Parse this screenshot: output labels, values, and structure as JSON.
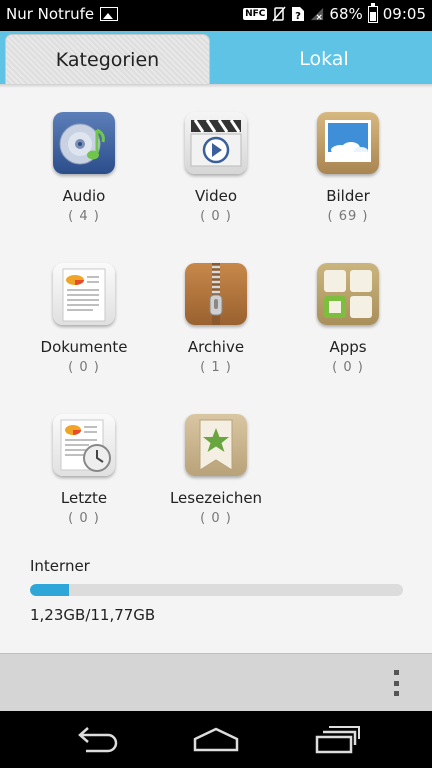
{
  "status_bar": {
    "carrier": "Nur Notrufe",
    "nfc": "NFC",
    "battery": "68%",
    "time": "09:05"
  },
  "tabs": [
    {
      "label": "Kategorien",
      "active": true
    },
    {
      "label": "Lokal",
      "active": false
    }
  ],
  "categories": [
    {
      "label": "Audio",
      "count": "( 4 )",
      "icon": "audio-icon"
    },
    {
      "label": "Video",
      "count": "( 0 )",
      "icon": "video-icon"
    },
    {
      "label": "Bilder",
      "count": "( 69 )",
      "icon": "pictures-icon"
    },
    {
      "label": "Dokumente",
      "count": "( 0 )",
      "icon": "documents-icon"
    },
    {
      "label": "Archive",
      "count": "( 1 )",
      "icon": "archive-icon"
    },
    {
      "label": "Apps",
      "count": "( 0 )",
      "icon": "apps-icon"
    },
    {
      "label": "Letzte",
      "count": "( 0 )",
      "icon": "recent-icon"
    },
    {
      "label": "Lesezeichen",
      "count": "( 0 )",
      "icon": "bookmark-icon"
    }
  ],
  "storage": {
    "label": "Interner",
    "usage_text": "1,23GB/11,77GB",
    "used_fraction": 0.105
  },
  "colors": {
    "tab_bar": "#5ec3e4",
    "progress": "#2ea6d8"
  }
}
